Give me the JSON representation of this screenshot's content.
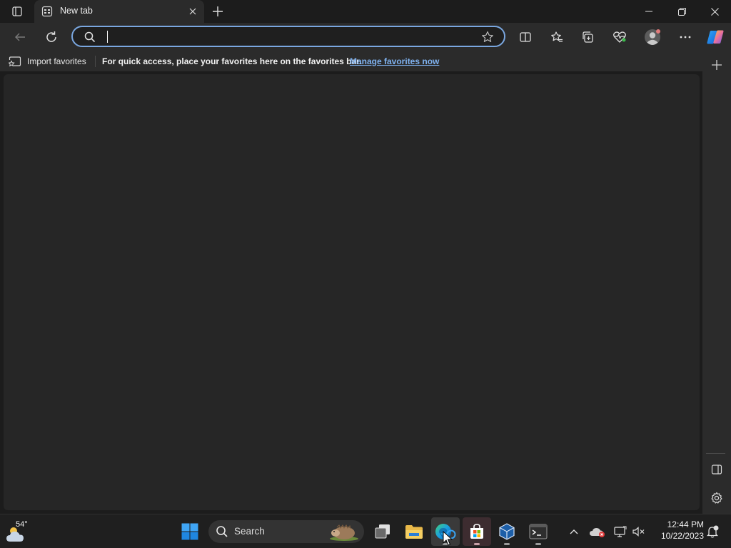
{
  "browser": {
    "tab": {
      "title": "New tab"
    },
    "address": {
      "value": "",
      "placeholder": ""
    },
    "favorites_bar": {
      "import_label": "Import favorites",
      "message": "For quick access, place your favorites here on the favorites bar.",
      "link_label": "Manage favorites now"
    },
    "toolbar_icons": [
      "back-icon",
      "refresh-icon",
      "split-screen-icon",
      "favorites-icon",
      "collections-icon",
      "browser-essentials-icon",
      "profile-icon",
      "more-icon",
      "copilot-icon"
    ],
    "sidebar_icons": [
      "add-icon",
      "sidebar-toggle-icon",
      "settings-icon"
    ]
  },
  "taskbar": {
    "weather": {
      "temp": "54°"
    },
    "search": {
      "label": "Search"
    },
    "apps": [
      "start-icon",
      "search",
      "task-view-icon",
      "file-explorer-icon",
      "edge-icon",
      "microsoft-store-icon",
      "virtualbox-icon",
      "terminal-icon"
    ],
    "clock": {
      "time": "12:44 PM",
      "date": "10/22/2023"
    }
  },
  "colors": {
    "accent": "#7aa7e0",
    "link": "#7fb2f0",
    "frame": "#2b2b2b",
    "content": "#262626"
  }
}
